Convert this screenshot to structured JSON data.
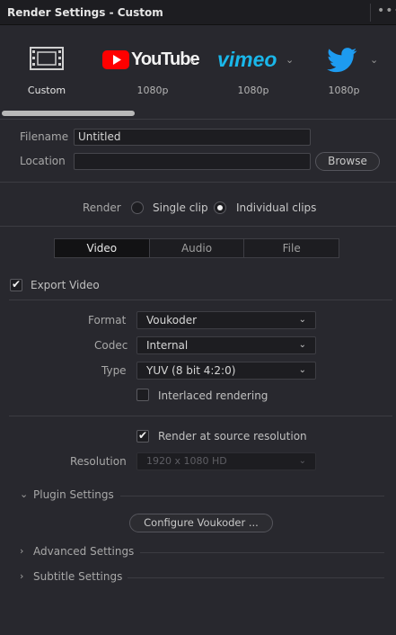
{
  "header": {
    "title": "Render Settings - Custom",
    "menu_glyph": "•••"
  },
  "presets": [
    {
      "name": "custom",
      "label": "Custom",
      "icon": "film-icon"
    },
    {
      "name": "youtube",
      "label": "1080p",
      "brand": "YouTube",
      "icon": "youtube-logo"
    },
    {
      "name": "vimeo",
      "label": "1080p",
      "brand": "vimeo",
      "icon": "vimeo-logo"
    },
    {
      "name": "twitter",
      "label": "1080p",
      "icon": "twitter-bird-icon"
    }
  ],
  "file": {
    "filename_label": "Filename",
    "filename_value": "Untitled",
    "location_label": "Location",
    "location_value": "",
    "browse_label": "Browse"
  },
  "render": {
    "label": "Render",
    "single_clip": "Single clip",
    "individual_clips": "Individual clips",
    "selected": "individual_clips"
  },
  "tabs": [
    {
      "label": "Video",
      "active": true
    },
    {
      "label": "Audio",
      "active": false
    },
    {
      "label": "File",
      "active": false
    }
  ],
  "video": {
    "export_video_label": "Export Video",
    "export_video_checked": true,
    "format_label": "Format",
    "format_value": "Voukoder",
    "codec_label": "Codec",
    "codec_value": "Internal",
    "type_label": "Type",
    "type_value": "YUV (8 bit 4:2:0)",
    "interlaced_label": "Interlaced rendering",
    "interlaced_checked": false,
    "render_source_label": "Render at source resolution",
    "render_source_checked": true,
    "resolution_label": "Resolution",
    "resolution_value": "1920 x 1080 HD"
  },
  "sections": {
    "plugin_settings": "Plugin Settings",
    "configure_button": "Configure Voukoder ...",
    "advanced_settings": "Advanced Settings",
    "subtitle_settings": "Subtitle Settings"
  },
  "colors": {
    "youtube_red": "#ff0000",
    "vimeo_blue": "#1ab7ea",
    "twitter_blue": "#1d9bf0"
  }
}
